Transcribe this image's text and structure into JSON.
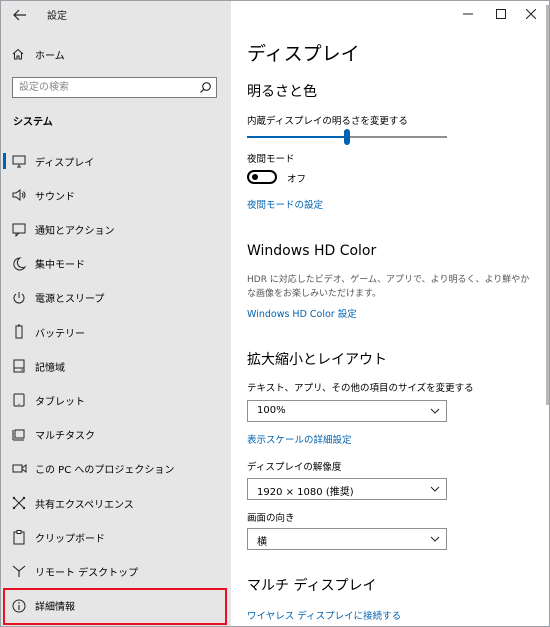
{
  "window": {
    "title": "設定"
  },
  "sidebar": {
    "home_label": "ホーム",
    "search_placeholder": "設定の検索",
    "section_label": "システム",
    "items": [
      {
        "label": "ディスプレイ",
        "icon": "monitor-icon",
        "active": true
      },
      {
        "label": "サウンド",
        "icon": "speaker-icon"
      },
      {
        "label": "通知とアクション",
        "icon": "notification-icon"
      },
      {
        "label": "集中モード",
        "icon": "moon-icon"
      },
      {
        "label": "電源とスリープ",
        "icon": "power-icon"
      },
      {
        "label": "バッテリー",
        "icon": "battery-icon"
      },
      {
        "label": "記憶域",
        "icon": "storage-icon"
      },
      {
        "label": "タブレット",
        "icon": "tablet-icon"
      },
      {
        "label": "マルチタスク",
        "icon": "multitask-icon"
      },
      {
        "label": "この PC へのプロジェクション",
        "icon": "projection-icon"
      },
      {
        "label": "共有エクスペリエンス",
        "icon": "shared-experiences-icon"
      },
      {
        "label": "クリップボード",
        "icon": "clipboard-icon"
      },
      {
        "label": "リモート デスクトップ",
        "icon": "remote-desktop-icon"
      },
      {
        "label": "詳細情報",
        "icon": "info-icon",
        "highlighted": true
      }
    ]
  },
  "main": {
    "title": "ディスプレイ",
    "brightness": {
      "heading": "明るさと色",
      "slider_label": "内蔵ディスプレイの明るさを変更する",
      "value_fraction": 0.5
    },
    "night_light": {
      "label": "夜間モード",
      "state": "オフ",
      "settings_link": "夜間モードの設定"
    },
    "hd_color": {
      "heading": "Windows HD Color",
      "description": "HDR に対応したビデオ、ゲーム、アプリで、より明るく、より鮮やかな画像をお楽しみいただけます。",
      "link": "Windows HD Color 設定"
    },
    "scale_layout": {
      "heading": "拡大縮小とレイアウト",
      "scale_label": "テキスト、アプリ、その他の項目のサイズを変更する",
      "scale_value": "100%",
      "advanced_link": "表示スケールの詳細設定",
      "resolution_label": "ディスプレイの解像度",
      "resolution_value": "1920 × 1080 (推奨)",
      "orientation_label": "画面の向き",
      "orientation_value": "横"
    },
    "multi_display": {
      "heading": "マルチ ディスプレイ",
      "wireless_link": "ワイヤレス ディスプレイに接続する"
    }
  },
  "colors": {
    "accent": "#0063b1",
    "highlight_border": "#e81123",
    "sidebar_bg": "#e6e6e6"
  }
}
